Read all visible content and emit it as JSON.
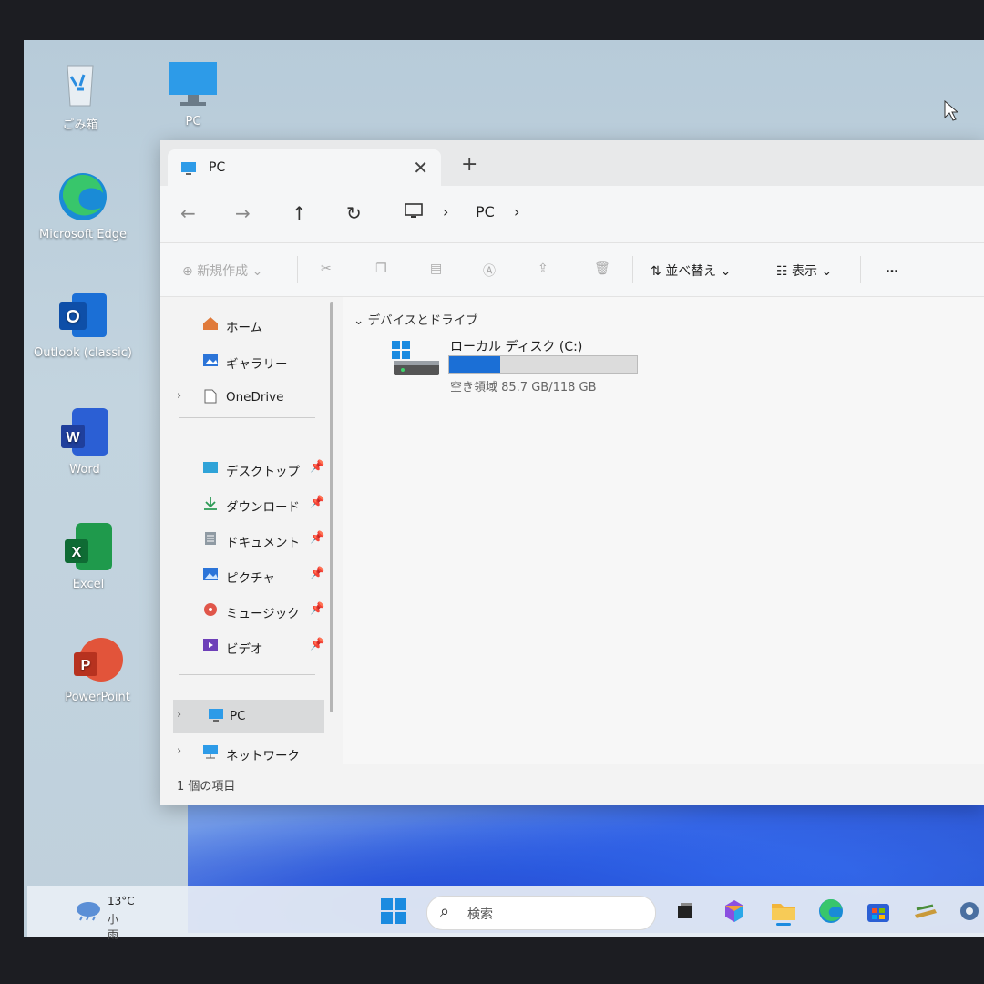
{
  "desktop": {
    "icons": [
      {
        "label": "ごみ箱",
        "icon": "recycle-bin-icon"
      },
      {
        "label": "PC",
        "icon": "monitor-icon"
      },
      {
        "label": "Microsoft Edge",
        "icon": "edge-icon"
      },
      {
        "label": "Outlook (classic)",
        "icon": "outlook-icon"
      },
      {
        "label": "Word",
        "icon": "word-icon"
      },
      {
        "label": "Excel",
        "icon": "excel-icon"
      },
      {
        "label": "PowerPoint",
        "icon": "powerpoint-icon"
      }
    ]
  },
  "window": {
    "tab_title": "PC",
    "new_tab": "+",
    "close_tab": "✕",
    "breadcrumb": [
      "PC"
    ],
    "toolbar": {
      "new_label": "新規作成",
      "sort_label": "並べ替え",
      "view_label": "表示",
      "more_label": "…"
    },
    "sidebar": {
      "top": [
        {
          "label": "ホーム",
          "icon": "home-icon"
        },
        {
          "label": "ギャラリー",
          "icon": "gallery-icon"
        },
        {
          "label": "OneDrive",
          "icon": "document-icon"
        }
      ],
      "pinned": [
        {
          "label": "デスクトップ",
          "icon": "desktop-folder-icon"
        },
        {
          "label": "ダウンロード",
          "icon": "download-icon"
        },
        {
          "label": "ドキュメント",
          "icon": "documents-icon"
        },
        {
          "label": "ピクチャ",
          "icon": "pictures-icon"
        },
        {
          "label": "ミュージック",
          "icon": "music-icon"
        },
        {
          "label": "ビデオ",
          "icon": "videos-icon"
        }
      ],
      "bottom": [
        {
          "label": "PC",
          "icon": "pc-icon",
          "selected": true
        },
        {
          "label": "ネットワーク",
          "icon": "network-icon"
        }
      ]
    },
    "main": {
      "group_label": "デバイスとドライブ",
      "drive_name": "ローカル ディスク (C:)",
      "drive_free": "空き領域 85.7 GB/118 GB",
      "used_fraction": 0.274
    },
    "status": "1 個の項目"
  },
  "taskbar": {
    "temp": "13°C",
    "condition": "小雨",
    "search_placeholder": "検索"
  },
  "colors": {
    "accent": "#1b6fd6",
    "selection": "#d9dadb"
  }
}
